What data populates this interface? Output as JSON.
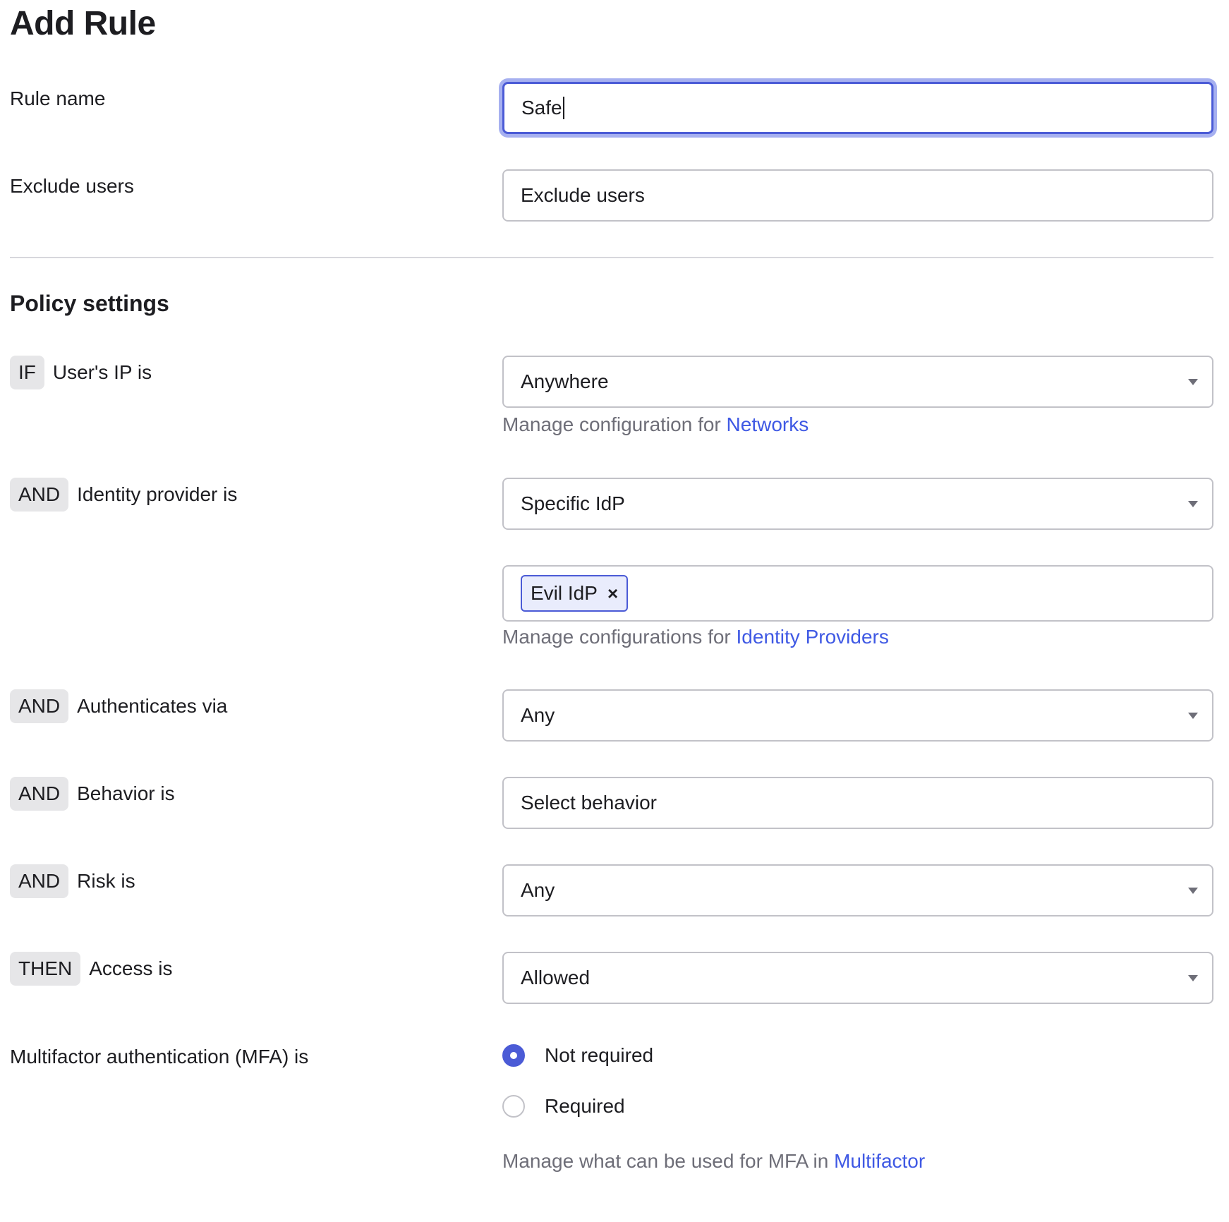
{
  "page": {
    "title": "Add Rule"
  },
  "rule_name": {
    "label": "Rule name",
    "value": "Safe"
  },
  "exclude_users": {
    "label": "Exclude users",
    "placeholder": "Exclude users"
  },
  "policy_settings": {
    "title": "Policy settings",
    "ip": {
      "badge": "IF",
      "label": "User's IP is",
      "value": "Anywhere",
      "helper_text": "Manage configuration for ",
      "helper_link": "Networks"
    },
    "identity_provider": {
      "badge": "AND",
      "label": "Identity provider is",
      "value": "Specific IdP",
      "selected": [
        {
          "label": "Evil IdP",
          "remove": "×"
        }
      ],
      "helper_text": "Manage configurations for ",
      "helper_link": "Identity Providers"
    },
    "authenticates_via": {
      "badge": "AND",
      "label": "Authenticates via",
      "value": "Any"
    },
    "behavior": {
      "badge": "AND",
      "label": "Behavior is",
      "placeholder": "Select behavior"
    },
    "risk": {
      "badge": "AND",
      "label": "Risk is",
      "value": "Any"
    },
    "access": {
      "badge": "THEN",
      "label": "Access is",
      "value": "Allowed"
    },
    "mfa": {
      "label": "Multifactor authentication (MFA) is",
      "options": [
        {
          "label": "Not required",
          "checked": true
        },
        {
          "label": "Required",
          "checked": false
        }
      ],
      "helper_text": "Manage what can be used for MFA in ",
      "helper_link": "Multifactor"
    }
  },
  "colors": {
    "accent": "#4b5bd6",
    "link": "#3f59e4",
    "badge_bg": "#e6e6e8",
    "border": "#c2c2c8"
  }
}
